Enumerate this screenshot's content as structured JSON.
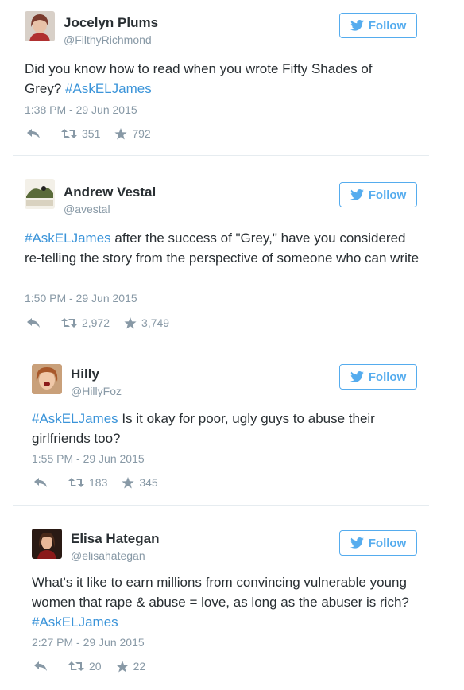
{
  "colors": {
    "accent": "#55acee",
    "hashtag": "#3b94d9",
    "meta": "#8899a6",
    "text": "#292f33"
  },
  "tweets": [
    {
      "name": "Jocelyn Plums",
      "handle": "@FilthyRichmond",
      "follow_label": "Follow",
      "text_before": "Did you know how to read when you wrote Fifty Shades of Grey? ",
      "hashtag": "#AskELJames",
      "text_after": "",
      "timestamp": "1:38 PM - 29 Jun 2015",
      "retweets": "351",
      "favorites": "792"
    },
    {
      "name": "Andrew Vestal",
      "handle": "@avestal",
      "follow_label": "Follow",
      "hashtag": "#AskELJames",
      "text_after": " after the success of \"Grey,\" have you considered re-telling the story from the perspective of someone who can write",
      "timestamp": "1:50 PM - 29 Jun 2015",
      "retweets": "2,972",
      "favorites": "3,749"
    },
    {
      "name": "Hilly",
      "handle": "@HillyFoz",
      "follow_label": "Follow",
      "hashtag": "#AskELJames",
      "text_after": " Is it okay for poor, ugly guys to abuse their girlfriends too?",
      "timestamp": "1:55 PM - 29 Jun 2015",
      "retweets": "183",
      "favorites": "345"
    },
    {
      "name": "Elisa Hategan",
      "handle": "@elisahategan",
      "follow_label": "Follow",
      "text_before": "What's it like to earn millions from convincing vulnerable young women that rape & abuse = love, as long as the abuser is rich? ",
      "hashtag": "#AskELJames",
      "timestamp": "2:27 PM - 29 Jun 2015",
      "retweets": "20",
      "favorites": "22"
    }
  ]
}
